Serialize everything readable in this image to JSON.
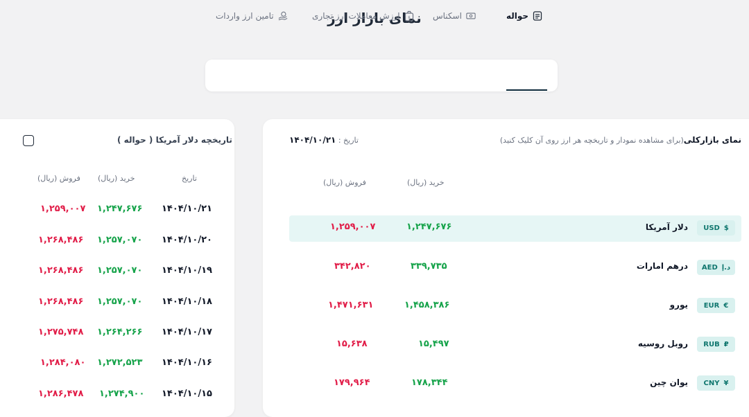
{
  "page": {
    "title": "نمای بازار ارز"
  },
  "tabs": [
    {
      "label": "حواله",
      "icon": "document-icon",
      "active": true
    },
    {
      "label": "اسکناس",
      "icon": "banknote-icon",
      "active": false
    },
    {
      "label": "ارزش معاملات ارز تجاری",
      "icon": "money-bag-icon",
      "active": false
    },
    {
      "label": "تامین ارز واردات",
      "icon": "hand-coin-icon",
      "active": false
    }
  ],
  "market": {
    "title": "نمای بازارکلی",
    "subtitle": "(برای مشاهده نمودار و تاریخچه هر ارز روی آن کلیک کنید)",
    "date_label": "تاریخ :",
    "date_value": "۱۴۰۴/۱۰/۲۱",
    "col_buy": "خرید (ریال)",
    "col_sell": "فروش (ریال)",
    "rows": [
      {
        "code": "USD",
        "symbol": "$",
        "name": "دلار آمریکا",
        "buy": "۱,۲۴۷,۶۷۶",
        "sell": "۱,۲۵۹,۰۰۷"
      },
      {
        "code": "AED",
        "symbol": "د.إ",
        "name": "درهم امارات",
        "buy": "۳۳۹,۷۳۵",
        "sell": "۳۴۲,۸۲۰"
      },
      {
        "code": "EUR",
        "symbol": "€",
        "name": "یورو",
        "buy": "۱,۴۵۸,۳۸۶",
        "sell": "۱,۴۷۱,۶۳۱"
      },
      {
        "code": "RUB",
        "symbol": "₽",
        "name": "روبل روسیه",
        "buy": "۱۵,۴۹۷",
        "sell": "۱۵,۶۳۸"
      },
      {
        "code": "CNY",
        "symbol": "¥",
        "name": "یوان چین",
        "buy": "۱۷۸,۳۴۴",
        "sell": "۱۷۹,۹۶۴"
      }
    ]
  },
  "history": {
    "title": "تاریخچه دلار آمریکا ( حواله )",
    "col_date": "تاریخ",
    "col_buy": "خرید (ریال)",
    "col_sell": "فروش (ریال)",
    "rows": [
      {
        "date": "۱۴۰۴/۱۰/۲۱",
        "buy": "۱,۲۴۷,۶۷۶",
        "sell": "۱,۲۵۹,۰۰۷"
      },
      {
        "date": "۱۴۰۴/۱۰/۲۰",
        "buy": "۱,۲۵۷,۰۷۰",
        "sell": "۱,۲۶۸,۴۸۶"
      },
      {
        "date": "۱۴۰۴/۱۰/۱۹",
        "buy": "۱,۲۵۷,۰۷۰",
        "sell": "۱,۲۶۸,۴۸۶"
      },
      {
        "date": "۱۴۰۴/۱۰/۱۸",
        "buy": "۱,۲۵۷,۰۷۰",
        "sell": "۱,۲۶۸,۴۸۶"
      },
      {
        "date": "۱۴۰۴/۱۰/۱۷",
        "buy": "۱,۲۶۴,۲۶۶",
        "sell": "۱,۲۷۵,۷۴۸"
      },
      {
        "date": "۱۴۰۴/۱۰/۱۶",
        "buy": "۱,۲۷۲,۵۲۳",
        "sell": "۱,۲۸۴,۰۸۰"
      },
      {
        "date": "۱۴۰۴/۱۰/۱۵",
        "buy": "۱,۲۷۴,۹۰۰",
        "sell": "۱,۲۸۶,۴۷۸"
      }
    ]
  },
  "colors": {
    "buy": "#16a34a",
    "sell": "#e11d48",
    "highlight": "#e6f6f5",
    "accent": "#0e2a3b"
  }
}
